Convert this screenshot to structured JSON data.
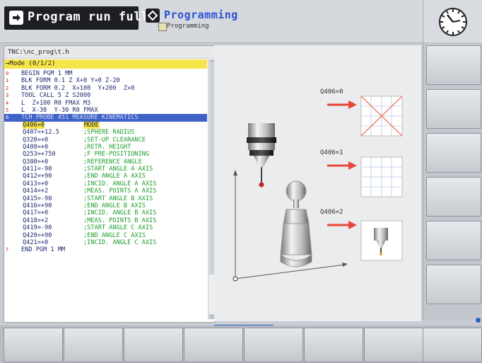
{
  "header": {
    "machine_mode": "Program run full…",
    "programming_mode": "Programming",
    "programming_sub": "Programming"
  },
  "program": {
    "path": "TNC:\\nc_prog\\t.h",
    "mode_line": "→Mode (0/1/2)",
    "lines": [
      {
        "n": "0",
        "text": "BEGIN PGM 1 MM",
        "comment": ""
      },
      {
        "n": "1",
        "text": "BLK FORM 0.1 Z X+0 Y+0 Z-20",
        "comment": ""
      },
      {
        "n": "2",
        "text": "BLK FORM 0.2  X+100  Y+200  Z+0",
        "comment": ""
      },
      {
        "n": "3",
        "text": "TOOL CALL 5 Z S2000",
        "comment": ""
      },
      {
        "n": "4",
        "text": "L  Z+100 R0 FMAX M3",
        "comment": ""
      },
      {
        "n": "5",
        "text": "L  X-30  Y-30 R0 FMAX",
        "comment": ""
      },
      {
        "n": "6",
        "text": "TCH PROBE 451 MEASURE KINEMATICS",
        "comment": ""
      },
      {
        "n": "",
        "text": "Q406=0",
        "comment": "MODE"
      },
      {
        "n": "",
        "text": "Q407=+12.5",
        "comment": ";SPHERE RADIUS"
      },
      {
        "n": "",
        "text": "Q320=+0",
        "comment": ";SET-UP CLEARANCE"
      },
      {
        "n": "",
        "text": "Q408=+0",
        "comment": ";RETR. HEIGHT"
      },
      {
        "n": "",
        "text": "Q253=+750",
        "comment": ";F PRE-POSITIONING"
      },
      {
        "n": "",
        "text": "Q380=+0",
        "comment": ";REFERENCE ANGLE"
      },
      {
        "n": "",
        "text": "Q411=-90",
        "comment": ";START ANGLE A AXIS"
      },
      {
        "n": "",
        "text": "Q412=+90",
        "comment": ";END ANGLE A AXIS"
      },
      {
        "n": "",
        "text": "Q413=+0",
        "comment": ";INCID. ANGLE A AXIS"
      },
      {
        "n": "",
        "text": "Q414=+2",
        "comment": ";MEAS. POINTS A AXIS"
      },
      {
        "n": "",
        "text": "Q415=-90",
        "comment": ";START ANGLE B AXIS"
      },
      {
        "n": "",
        "text": "Q416=+90",
        "comment": ";END ANGLE B AXIS"
      },
      {
        "n": "",
        "text": "Q417=+0",
        "comment": ";INCID. ANGLE B AXIS"
      },
      {
        "n": "",
        "text": "Q418=+2",
        "comment": ";MEAS. POINTS B AXIS"
      },
      {
        "n": "",
        "text": "Q419=-90",
        "comment": ";START ANGLE C AXIS"
      },
      {
        "n": "",
        "text": "Q420=+90",
        "comment": ";END ANGLE C AXIS"
      },
      {
        "n": "",
        "text": "Q421=+0",
        "comment": ";INCID. ANGLE C AXIS"
      },
      {
        "n": "7",
        "text": "END PGM 1 MM",
        "comment": ""
      }
    ]
  },
  "figure": {
    "opt0": "Q406=0",
    "opt1": "Q406=1",
    "opt2": "Q406=2"
  },
  "colors": {
    "accent": "#2d5ec2",
    "highlight": "#f6e54a",
    "comment_green": "#1c9e2a",
    "line_number_red": "#d82020",
    "arrow_red": "#e8463a"
  },
  "icons": {
    "machine_mode": "arrow-right-icon",
    "programming_mode": "arrow-icon",
    "clock": "clock-icon"
  }
}
